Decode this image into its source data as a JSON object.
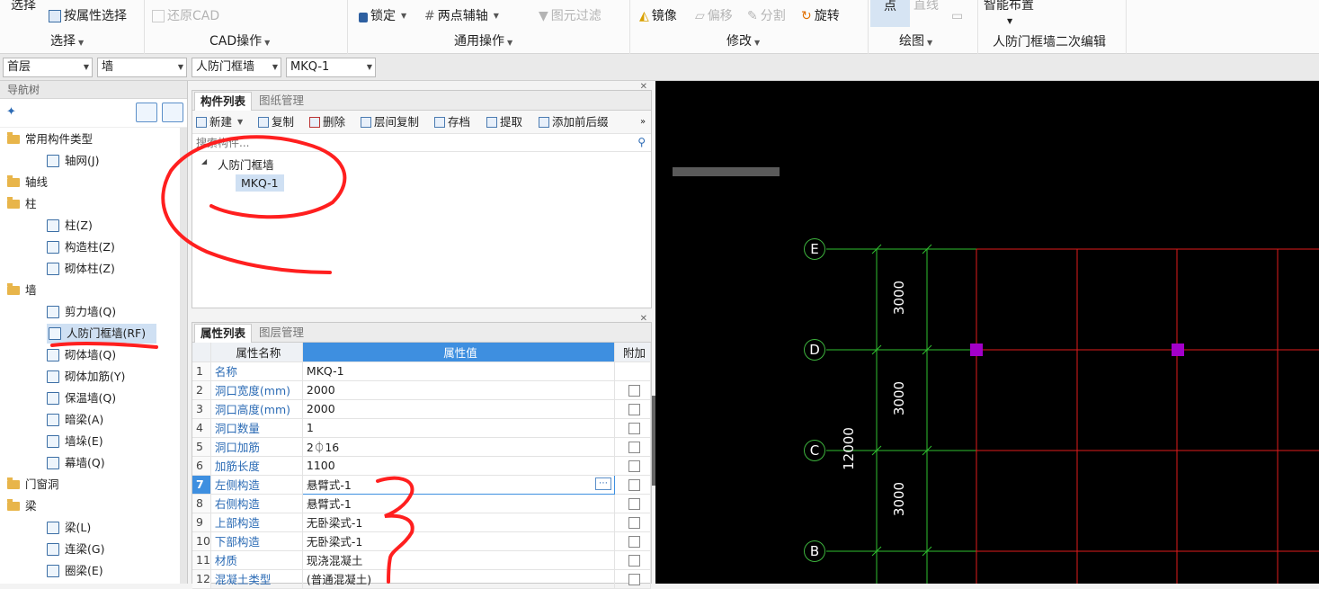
{
  "ribbon": {
    "select_top": "选择",
    "select_by_property": "按属性选择",
    "restore_cad": "还原CAD",
    "lock": "锁定",
    "two_point_axis": "两点辅轴",
    "filter_elements": "图元过滤",
    "mirror": "镜像",
    "offset": "偏移",
    "split": "分割",
    "rotate": "旋转",
    "point": "点",
    "line": "直线",
    "smart_layout": "智能布置",
    "groups": {
      "select": "选择",
      "cad_ops": "CAD操作",
      "common_ops": "通用操作",
      "modify": "修改",
      "draw": "绘图",
      "secondary_edit": "人防门框墙二次编辑"
    }
  },
  "filters": {
    "floor": "首层",
    "category": "墙",
    "type": "人防门框墙",
    "component": "MKQ-1"
  },
  "nav": {
    "header": "导航树",
    "items": [
      {
        "label": "常用构件类型",
        "kind": "folder"
      },
      {
        "label": "轴网(J)",
        "kind": "child"
      },
      {
        "label": "轴线",
        "kind": "folder"
      },
      {
        "label": "柱",
        "kind": "folder"
      },
      {
        "label": "柱(Z)",
        "kind": "child"
      },
      {
        "label": "构造柱(Z)",
        "kind": "child"
      },
      {
        "label": "砌体柱(Z)",
        "kind": "child"
      },
      {
        "label": "墙",
        "kind": "folder"
      },
      {
        "label": "剪力墙(Q)",
        "kind": "child"
      },
      {
        "label": "人防门框墙(RF)",
        "kind": "child",
        "selected": true
      },
      {
        "label": "砌体墙(Q)",
        "kind": "child"
      },
      {
        "label": "砌体加筋(Y)",
        "kind": "child"
      },
      {
        "label": "保温墙(Q)",
        "kind": "child"
      },
      {
        "label": "暗梁(A)",
        "kind": "child"
      },
      {
        "label": "墙垛(E)",
        "kind": "child"
      },
      {
        "label": "幕墙(Q)",
        "kind": "child"
      },
      {
        "label": "门窗洞",
        "kind": "folder"
      },
      {
        "label": "梁",
        "kind": "folder"
      },
      {
        "label": "梁(L)",
        "kind": "child"
      },
      {
        "label": "连梁(G)",
        "kind": "child"
      },
      {
        "label": "圈梁(E)",
        "kind": "child"
      }
    ]
  },
  "components_panel": {
    "tab_active": "构件列表",
    "tab_inactive": "图纸管理",
    "toolbar": [
      "新建",
      "复制",
      "删除",
      "层间复制",
      "存档",
      "提取",
      "添加前后缀"
    ],
    "search_placeholder": "搜索构件...",
    "tree_root": "人防门框墙",
    "tree_child": "MKQ-1"
  },
  "props_panel": {
    "tab_active": "属性列表",
    "tab_inactive": "图层管理",
    "col_name": "属性名称",
    "col_value": "属性值",
    "col_extra": "附加",
    "rows": [
      {
        "num": "1",
        "name": "名称",
        "value": "MKQ-1",
        "has_check": false
      },
      {
        "num": "2",
        "name": "洞口宽度(mm)",
        "value": "2000",
        "has_check": true
      },
      {
        "num": "3",
        "name": "洞口高度(mm)",
        "value": "2000",
        "has_check": true
      },
      {
        "num": "4",
        "name": "洞口数量",
        "value": "1",
        "has_check": true
      },
      {
        "num": "5",
        "name": "洞口加筋",
        "value": "2⏀16",
        "has_check": true
      },
      {
        "num": "6",
        "name": "加筋长度",
        "value": "1100",
        "has_check": true
      },
      {
        "num": "7",
        "name": "左侧构造",
        "value": "悬臂式-1",
        "has_check": true
      },
      {
        "num": "8",
        "name": "右侧构造",
        "value": "悬臂式-1",
        "has_check": true
      },
      {
        "num": "9",
        "name": "上部构造",
        "value": "无卧梁式-1",
        "has_check": true
      },
      {
        "num": "10",
        "name": "下部构造",
        "value": "无卧梁式-1",
        "has_check": true
      },
      {
        "num": "11",
        "name": "材质",
        "value": "现浇混凝土",
        "has_check": true
      },
      {
        "num": "12",
        "name": "混凝土类型",
        "value": "(普通混凝土)",
        "has_check": true
      }
    ]
  },
  "cad": {
    "axes": [
      "E",
      "D",
      "C",
      "B"
    ],
    "dims": [
      "3000",
      "3000",
      "3000"
    ],
    "total": "12000",
    "colors": {
      "grid_green": "#2fbf2f",
      "grid_red": "#e01b1b",
      "node": "#a300c9"
    }
  }
}
